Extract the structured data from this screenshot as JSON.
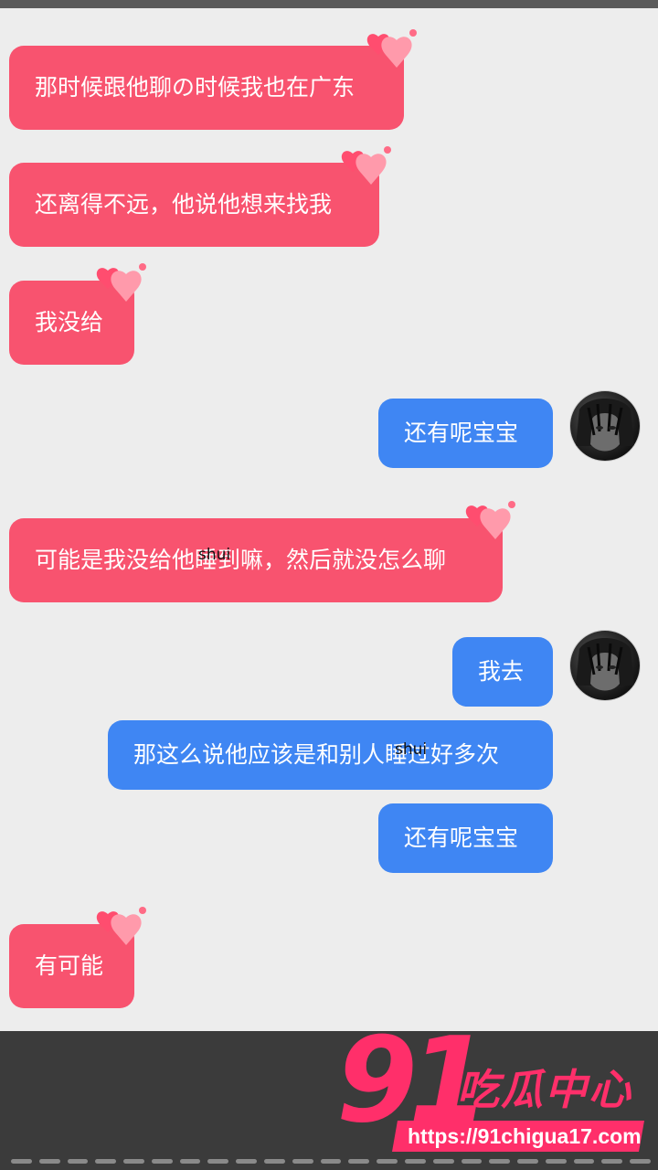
{
  "messages": [
    {
      "side": "left",
      "text": "那时候跟他聊の时候我也在广东"
    },
    {
      "side": "left",
      "text": "还离得不远，他说他想来找我"
    },
    {
      "side": "left",
      "text": "我没给"
    },
    {
      "side": "right",
      "text": "还有呢宝宝"
    },
    {
      "side": "left",
      "text": "可能是我没给他睡到嘛，然后就没怎么聊"
    },
    {
      "side": "right",
      "text": "我去"
    },
    {
      "side": "right",
      "text": "那这么说他应该是和别人睡过好多次"
    },
    {
      "side": "right",
      "text": "还有呢宝宝"
    },
    {
      "side": "left",
      "text": "有可能"
    }
  ],
  "annotations": {
    "censor_1": "shui",
    "censor_2": "shui"
  },
  "watermark": {
    "number": "91",
    "name": "吃瓜中心",
    "url": "https://91chigua17.com"
  },
  "colors": {
    "left_bubble": "#f8536f",
    "right_bubble": "#3f86f3",
    "background": "#ededed",
    "watermark": "#ff2f6a",
    "bottom_bar": "#3b3b3b"
  },
  "icons": {
    "bubble_decoration": "hearts-icon",
    "avatar": "avatar-dark-portrait"
  }
}
